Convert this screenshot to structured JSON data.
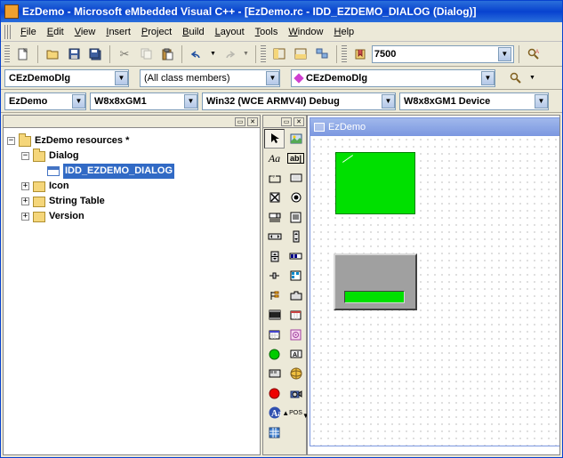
{
  "window": {
    "title": "EzDemo - Microsoft eMbedded Visual C++ - [EzDemo.rc - IDD_EZDEMO_DIALOG (Dialog)]"
  },
  "menu": {
    "file": "File",
    "edit": "Edit",
    "view": "View",
    "insert": "Insert",
    "project": "Project",
    "build": "Build",
    "layout": "Layout",
    "tools": "Tools",
    "window": "Window",
    "help": "Help"
  },
  "toolbar": {
    "zoom_value": "7500"
  },
  "class_bar": {
    "class": "CEzDemoDlg",
    "filter": "(All class members)",
    "member": "CEzDemoDlg"
  },
  "config_bar": {
    "project": "EzDemo",
    "sdk": "W8x8xGM1",
    "config": "Win32 (WCE ARMV4I) Debug",
    "device": "W8x8xGM1 Device"
  },
  "tree": {
    "root": "EzDemo resources *",
    "dialog_folder": "Dialog",
    "dialog_item": "IDD_EZDEMO_DIALOG",
    "icon_folder": "Icon",
    "string_folder": "String Table",
    "version_folder": "Version"
  },
  "dialog": {
    "title": "EzDemo"
  }
}
